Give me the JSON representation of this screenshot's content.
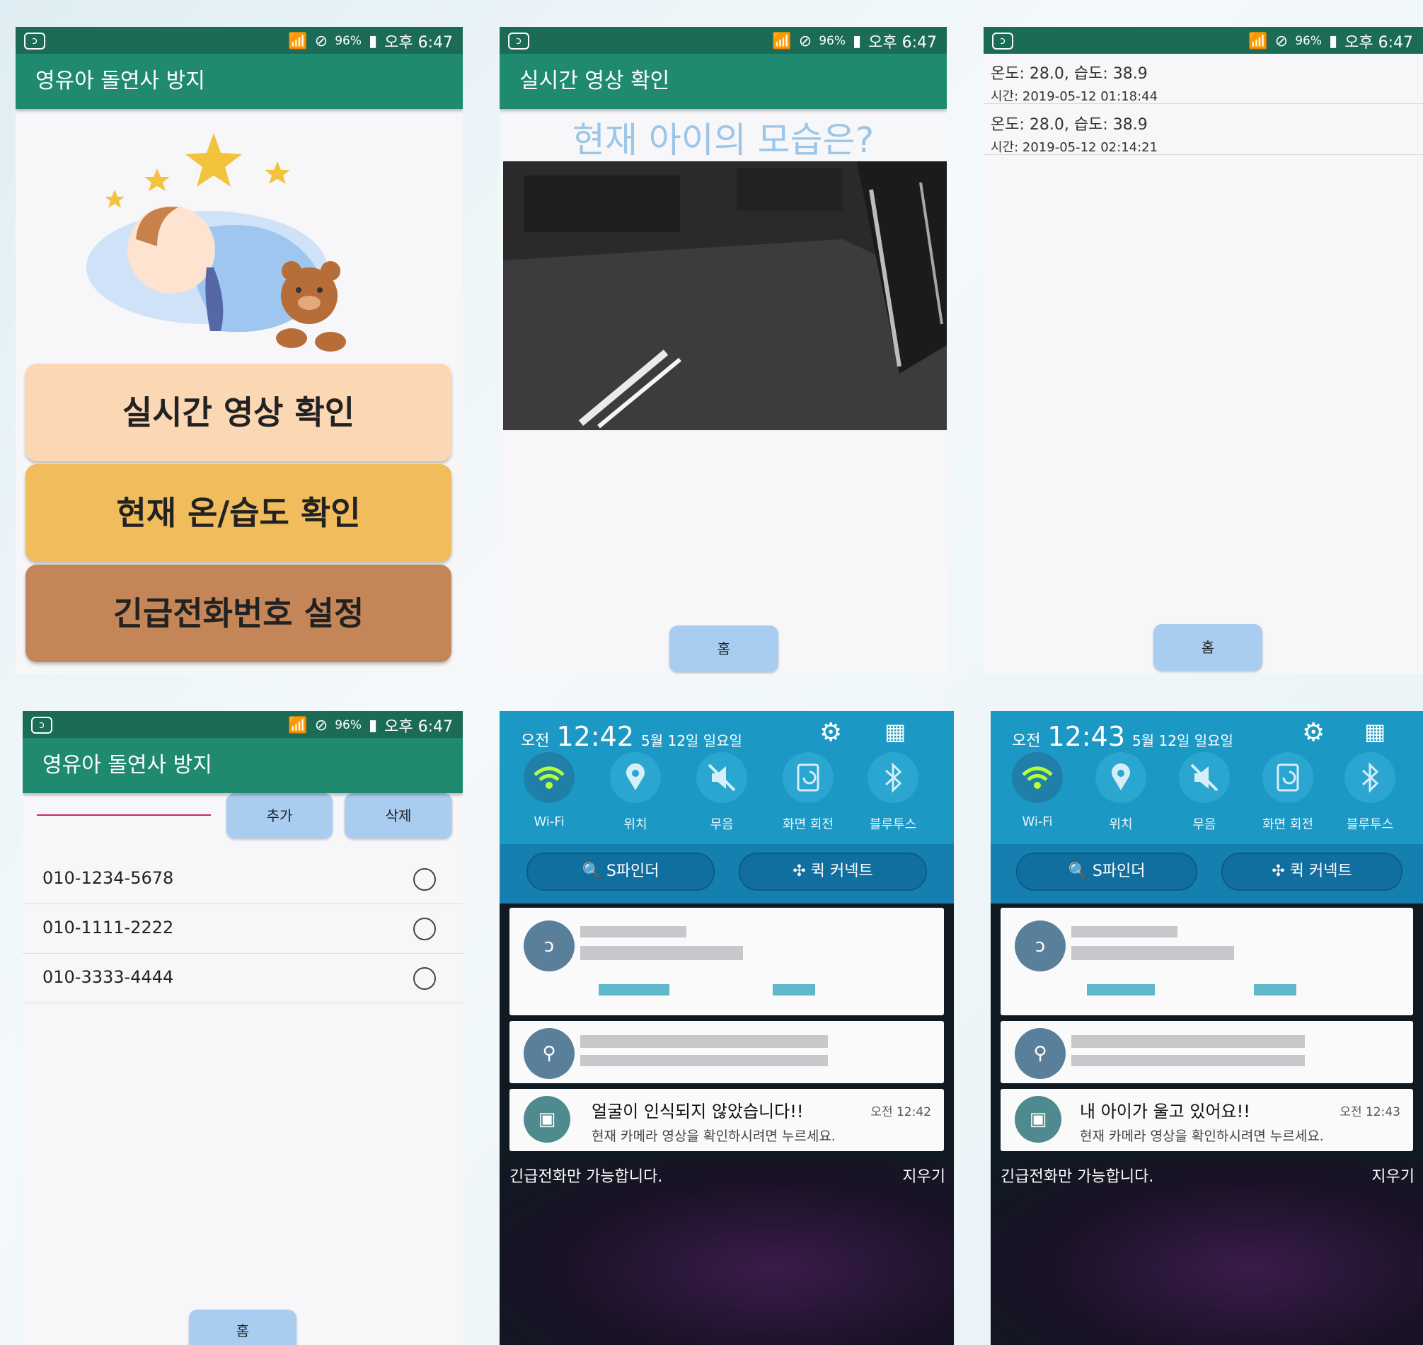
{
  "status": {
    "battery": "96%",
    "time": "오후 6:47"
  },
  "screen1": {
    "title": "영유아 돌연사 방지",
    "buttons": [
      "실시간 영상 확인",
      "현재 온/습도 확인",
      "긴급전화번호 설정"
    ],
    "colors": [
      "#fcd7b3",
      "#f0bc5c",
      "#c48658"
    ]
  },
  "screen2": {
    "title": "실시간 영상 확인",
    "heading": "현재 아이의 모습은?",
    "home": "홈"
  },
  "screen3": {
    "rows": [
      {
        "reading": "온도: 28.0, 습도: 38.9",
        "time": "시간: 2019-05-12 01:18:44"
      },
      {
        "reading": "온도: 28.0, 습도: 38.9",
        "time": "시간: 2019-05-12 02:14:21"
      }
    ],
    "home": "홈"
  },
  "screen4": {
    "title": "영유아 돌연사 방지",
    "add": "추가",
    "delete": "삭제",
    "contacts": [
      "010-1234-5678",
      "010-1111-2222",
      "010-3333-4444"
    ],
    "home": "홈"
  },
  "qs_labels": [
    "Wi-Fi",
    "위치",
    "무음",
    "화면 회전",
    "블루투스"
  ],
  "search_labels": [
    "S파인더",
    "퀵 커넥트"
  ],
  "screen5": {
    "ampm": "오전",
    "time": "12:42",
    "date": "5월 12일 일요일",
    "noti_title": "얼굴이 인식되지 않았습니다!!",
    "noti_time": "오전 12:42",
    "noti_sub": "현재 카메라 영상을 확인하시려면 누르세요.",
    "emergency": "긴급전화만 가능합니다.",
    "clear": "지우기"
  },
  "screen6": {
    "ampm": "오전",
    "time": "12:43",
    "date": "5월 12일 일요일",
    "noti_title": "내 아이가 울고 있어요!!",
    "noti_time": "오전 12:43",
    "noti_sub": "현재 카메라 영상을 확인하시려면 누르세요.",
    "emergency": "긴급전화만 가능합니다.",
    "clear": "지우기"
  }
}
